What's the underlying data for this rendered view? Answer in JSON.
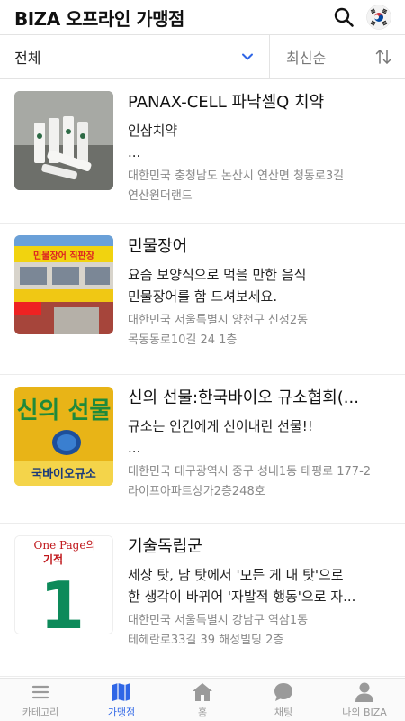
{
  "header": {
    "title": "BIZA 오프라인 가맹점",
    "search_icon": "search-icon",
    "language_icon": "korea-flag-icon"
  },
  "filter": {
    "category": "전체",
    "sort": "최신순"
  },
  "stores": [
    {
      "name": "PANAX-CELL 파낙셀Q 치약",
      "desc": [
        "인삼치약",
        "..."
      ],
      "addr": [
        "대한민국 충청남도 논산시 연산면 청동로3길",
        "연산원더랜드"
      ]
    },
    {
      "name": "민물장어",
      "desc": [
        "요즘 보양식으로 먹을 만한 음식",
        "민물장어를 함 드셔보세요."
      ],
      "addr": [
        "대한민국 서울특별시 양천구 신정2동",
        "목동동로10길 24 1층"
      ],
      "sign_text": "민물장어 직판장"
    },
    {
      "name": "신의 선물:한국바이오 규소협회(...",
      "desc": [
        "규소는 인간에게 신이내린 선물!!",
        "..."
      ],
      "addr": [
        "대한민국 대구광역시 중구 성내1동 태평로 177-2",
        "라이프아파트상가2층248호"
      ],
      "sign_text": [
        "신의 선물",
        "국바이오규소"
      ]
    },
    {
      "name": "기술독립군",
      "desc": [
        "세상 탓, 남 탓에서 '모든 게 내 탓'으로",
        "한 생각이 바뀌어 '자발적 행동'으로 자..."
      ],
      "addr": [
        "대한민국 서울특별시 강남구 역삼1동",
        "테헤란로33길 39 해성빌딩 2층"
      ],
      "cover_text": [
        "One Page의",
        "기적",
        "1"
      ]
    }
  ],
  "tabs": [
    {
      "label": "카테고리",
      "icon": "menu-icon",
      "active": false
    },
    {
      "label": "가맹점",
      "icon": "map-icon",
      "active": true
    },
    {
      "label": "홈",
      "icon": "home-icon",
      "active": false
    },
    {
      "label": "채팅",
      "icon": "chat-icon",
      "active": false
    },
    {
      "label": "나의 BIZA",
      "icon": "user-icon",
      "active": false
    }
  ],
  "colors": {
    "accent": "#2f66e6",
    "inactive": "#9a9a9a"
  }
}
